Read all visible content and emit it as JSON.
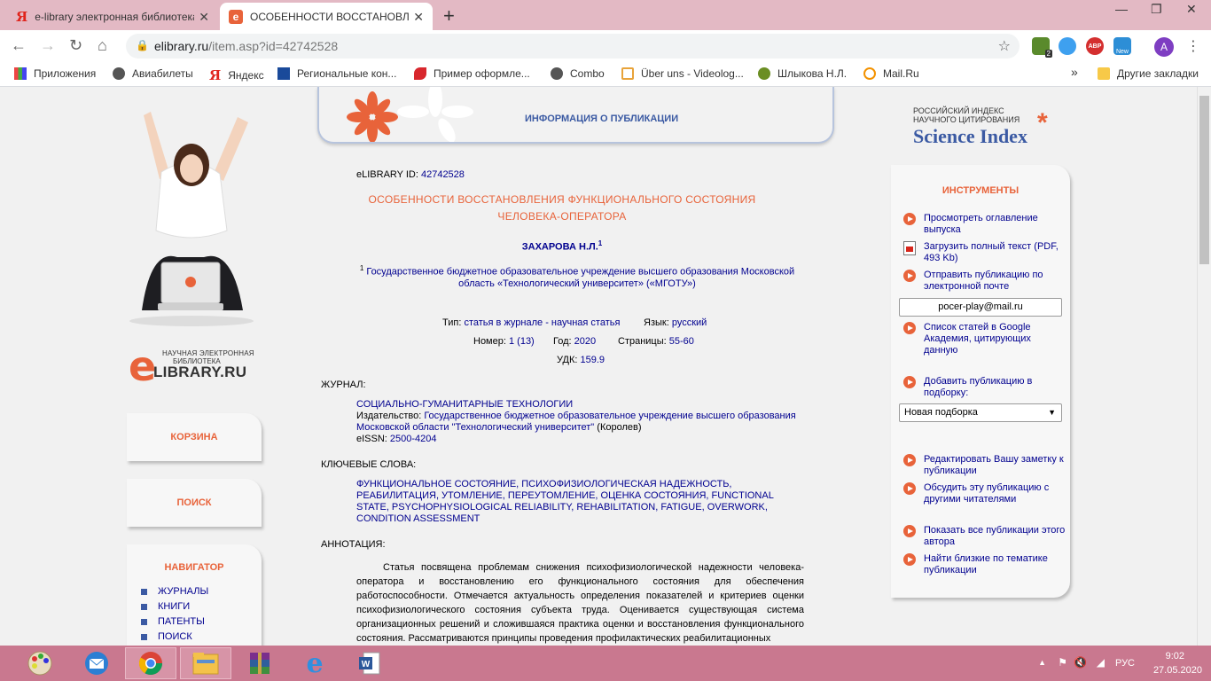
{
  "browser": {
    "tabs": [
      {
        "title": "e-library электронная библиотека",
        "close": "✕"
      },
      {
        "title": "ОСОБЕННОСТИ ВОССТАНОВЛЕНИЯ",
        "close": "✕"
      }
    ],
    "new_tab": "+",
    "window_controls": {
      "minimize": "—",
      "maximize": "❐",
      "close": "✕"
    },
    "url_host": "elibrary.ru",
    "url_path": "/item.asp?id=42742528",
    "bookmarks": [
      "Приложения",
      "Авиабилеты",
      "Яндекс",
      "Региональные кон...",
      "Пример оформле...",
      "Combo",
      "Über uns - Videolog...",
      "Шлыкова Н.Л.",
      "Mail.Ru"
    ],
    "bookmarks_more": "»",
    "other_bookmarks": "Другие закладки",
    "ext_badge": "2",
    "ext_abp": "ABP",
    "ext_new": "New",
    "avatar_letter": "A"
  },
  "sidebar": {
    "logo_line1": "НАУЧНАЯ ЭЛЕКТРОННАЯ",
    "logo_line2": "БИБЛИОТЕКА",
    "logo_e": "e",
    "logo_name": "LIBRARY.RU",
    "cart": "КОРЗИНА",
    "search": "ПОИСК",
    "navigator": "НАВИГАТОР",
    "nav_items": [
      "ЖУРНАЛЫ",
      "КНИГИ",
      "ПАТЕНТЫ",
      "ПОИСК"
    ]
  },
  "banner_title": "ИНФОРМАЦИЯ О ПУБЛИКАЦИИ",
  "publication": {
    "id_label": "eLIBRARY ID:",
    "id_value": "42742528",
    "title_line1": "ОСОБЕННОСТИ ВОССТАНОВЛЕНИЯ ФУНКЦИОНАЛЬНОГО СОСТОЯНИЯ",
    "title_line2": "ЧЕЛОВЕКА-ОПЕРАТОРА",
    "author": "ЗАХАРОВА Н.Л.",
    "author_sup": "1",
    "affil_sup": "1",
    "affiliation": "Государственное бюджетное образовательное учреждение высшего образования Московской область «Технологический университет» («МГОТУ»)",
    "type_label": "Тип:",
    "type_value": "статья в журнале - научная статья",
    "lang_label": "Язык:",
    "lang_value": "русский",
    "number_label": "Номер:",
    "number_value": "1 (13)",
    "year_label": "Год:",
    "year_value": "2020",
    "pages_label": "Страницы:",
    "pages_value": "55-60",
    "udk_label": "УДК:",
    "udk_value": "159.9",
    "journal_label": "ЖУРНАЛ:",
    "journal_name": "СОЦИАЛЬНО-ГУМАНИТАРНЫЕ ТЕХНОЛОГИИ",
    "publisher_label": "Издательство:",
    "publisher_value": "Государственное бюджетное образовательное учреждение высшего образования Московской области \"Технологический университет\"",
    "publisher_city": "(Королев)",
    "eissn_label": "eISSN:",
    "eissn_value": "2500-4204",
    "keywords_label": "КЛЮЧЕВЫЕ СЛОВА:",
    "keywords": "ФУНКЦИОНАЛЬНОЕ СОСТОЯНИЕ, ПСИХОФИЗИОЛОГИЧЕСКАЯ НАДЕЖНОСТЬ, РЕАБИЛИТАЦИЯ, УТОМЛЕНИЕ, ПЕРЕУТОМЛЕНИЕ, ОЦЕНКА СОСТОЯНИЯ, FUNCTIONAL STATE, PSYCHOPHYSIOLOGICAL RELIABILITY, REHABILITATION, FATIGUE, OVERWORK, CONDITION ASSESSMENT",
    "abstract_label": "АННОТАЦИЯ:",
    "abstract": "Статья посвящена проблемам снижения психофизиологической надежности человека-оператора и восстановлению его функционального состояния для обеспечения работоспособности. Отмечается актуальность определения показателей и критериев оценки психофизиологического состояния субъекта труда. Оценивается существующая система организационных решений и сложившаяся практика оценки и восстановления функционального состояния. Рассматриваются принципы проведения профилактических реабилитационных"
  },
  "science_index": {
    "line1": "РОССИЙСКИЙ ИНДЕКС",
    "line2": "НАУЧНОГО ЦИТИРОВАНИЯ",
    "name": "Science Index",
    "asterisk": "*"
  },
  "tools": {
    "title": "ИНСТРУМЕНТЫ",
    "toc": "Просмотреть оглавление выпуска",
    "fulltext": "Загрузить полный текст (PDF, 493 Kb)",
    "email": "Отправить публикацию по электронной почте",
    "email_value": "pocer-play@mail.ru",
    "google": "Список статей в Google Академия, цитирующих данную",
    "collection": "Добавить публикацию в подборку:",
    "collection_value": "Новая подборка",
    "note": "Редактировать Вашу заметку к публикации",
    "discuss": "Обсудить эту публикацию с другими читателями",
    "author_pubs": "Показать все публикации этого автора",
    "similar": "Найти близкие по тематике публикации"
  },
  "taskbar": {
    "lang": "РУС",
    "time": "9:02",
    "date": "27.05.2020"
  }
}
